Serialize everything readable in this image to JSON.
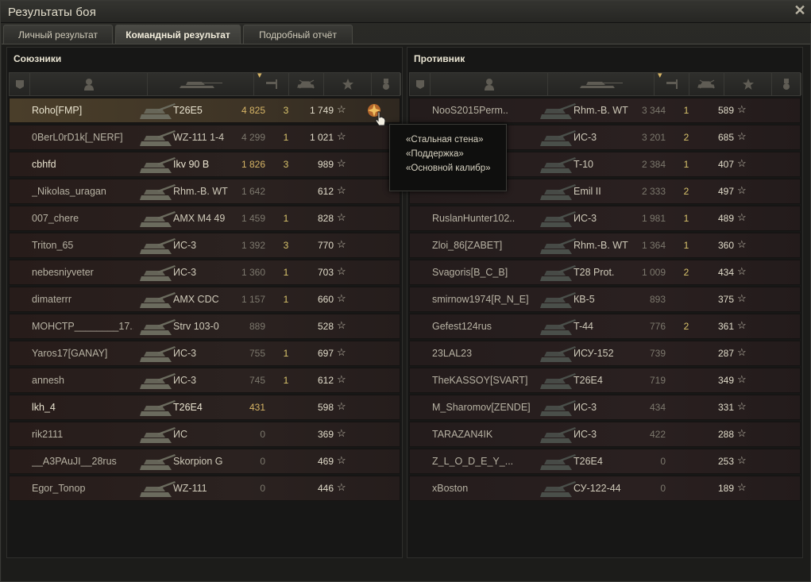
{
  "window": {
    "title": "Результаты боя"
  },
  "tabs": [
    {
      "label": "Личный результат"
    },
    {
      "label": "Командный результат"
    },
    {
      "label": "Подробный отчёт"
    }
  ],
  "allies": {
    "title": "Союзники",
    "rows": [
      {
        "name": "Roho[FMP]",
        "tank": "T26E5",
        "damage": "4 825",
        "kills": "3",
        "xp": "1 749",
        "me": true,
        "achievement": true
      },
      {
        "name": "0BerL0rD1k[_NERF]",
        "tank": "WZ-111 1-4",
        "damage": "4 299",
        "kills": "1",
        "xp": "1 021"
      },
      {
        "name": "cbhfd",
        "tank": "Ikv 90 B",
        "damage": "1 826",
        "kills": "3",
        "xp": "989",
        "highlight": true
      },
      {
        "name": "_Nikolas_uragan",
        "tank": "Rhm.-B. WT",
        "damage": "1 642",
        "kills": "",
        "xp": "612"
      },
      {
        "name": "007_chere",
        "tank": "AMX M4 49",
        "damage": "1 459",
        "kills": "1",
        "xp": "828"
      },
      {
        "name": "Triton_65",
        "tank": "ИС-3",
        "damage": "1 392",
        "kills": "3",
        "xp": "770"
      },
      {
        "name": "nebesniyveter",
        "tank": "ИС-3",
        "damage": "1 360",
        "kills": "1",
        "xp": "703"
      },
      {
        "name": "dimaterrr",
        "tank": "AMX CDC",
        "damage": "1 157",
        "kills": "1",
        "xp": "660"
      },
      {
        "name": "МОНСТР________17..",
        "tank": "Strv 103-0",
        "damage": "889",
        "kills": "",
        "xp": "528"
      },
      {
        "name": "Yaros17[GANAY]",
        "tank": "ИС-3",
        "damage": "755",
        "kills": "1",
        "xp": "697"
      },
      {
        "name": "annesh",
        "tank": "ИС-3",
        "damage": "745",
        "kills": "1",
        "xp": "612"
      },
      {
        "name": "lkh_4",
        "tank": "T26E4",
        "damage": "431",
        "kills": "",
        "xp": "598",
        "highlight": true
      },
      {
        "name": "rik2111",
        "tank": "ИС",
        "damage": "0",
        "kills": "",
        "xp": "369"
      },
      {
        "name": "__A3PAuJI__28rus",
        "tank": "Skorpion G",
        "damage": "0",
        "kills": "",
        "xp": "469"
      },
      {
        "name": "Egor_Tonop",
        "tank": "WZ-111",
        "damage": "0",
        "kills": "",
        "xp": "446"
      }
    ]
  },
  "enemies": {
    "title": "Противник",
    "rows": [
      {
        "name": "NooS2015Perm..",
        "tank": "Rhm.-B. WT",
        "damage": "3 344",
        "kills": "1",
        "xp": "589"
      },
      {
        "name": "",
        "tank": "ИС-3",
        "damage": "3 201",
        "kills": "2",
        "xp": "685"
      },
      {
        "name": "",
        "tank": "T-10",
        "damage": "2 384",
        "kills": "1",
        "xp": "407"
      },
      {
        "name": "",
        "tank": "Emil II",
        "damage": "2 333",
        "kills": "2",
        "xp": "497"
      },
      {
        "name": "RuslanHunter102..",
        "tank": "ИС-3",
        "damage": "1 981",
        "kills": "1",
        "xp": "489"
      },
      {
        "name": "Zloi_86[ZABET]",
        "tank": "Rhm.-B. WT",
        "damage": "1 364",
        "kills": "1",
        "xp": "360"
      },
      {
        "name": "Svagoris[B_C_B]",
        "tank": "T28 Prot.",
        "damage": "1 009",
        "kills": "2",
        "xp": "434"
      },
      {
        "name": "smirnow1974[R_N_E]",
        "tank": "КВ-5",
        "damage": "893",
        "kills": "",
        "xp": "375"
      },
      {
        "name": "Gefest124rus",
        "tank": "T-44",
        "damage": "776",
        "kills": "2",
        "xp": "361"
      },
      {
        "name": "23LAL23",
        "tank": "ИСУ-152",
        "damage": "739",
        "kills": "",
        "xp": "287"
      },
      {
        "name": "TheKASSOY[SVART]",
        "tank": "T26E4",
        "damage": "719",
        "kills": "",
        "xp": "349"
      },
      {
        "name": "M_Sharomov[ZENDE]",
        "tank": "ИС-3",
        "damage": "434",
        "kills": "",
        "xp": "331"
      },
      {
        "name": "TARAZAN4IK",
        "tank": "ИС-3",
        "damage": "422",
        "kills": "",
        "xp": "288"
      },
      {
        "name": "Z_L_O_D_E_Y_...",
        "tank": "T26E4",
        "damage": "0",
        "kills": "",
        "xp": "253"
      },
      {
        "name": "xBoston",
        "tank": "СУ-122-44",
        "damage": "0",
        "kills": "",
        "xp": "189"
      }
    ]
  },
  "tooltip": {
    "lines": [
      "«Стальная стена»",
      "«Поддержка»",
      "«Основной калибр»"
    ]
  },
  "colors": {
    "accent_gold": "#d7b566",
    "kills_yellow": "#d9c46c",
    "row_red": "#2b2220",
    "row_me": "#4a3e2a"
  }
}
